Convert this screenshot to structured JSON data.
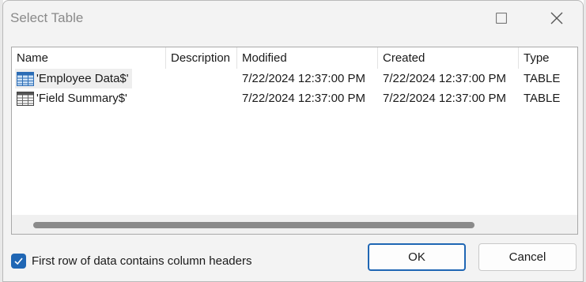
{
  "window": {
    "title": "Select Table"
  },
  "table": {
    "columns": [
      "Name",
      "Description",
      "Modified",
      "Created",
      "Type"
    ],
    "rows": [
      {
        "name": "'Employee Data$'",
        "description": "",
        "modified": "7/22/2024 12:37:00 PM",
        "created": "7/22/2024 12:37:00 PM",
        "type": "TABLE",
        "icon": "table-icon"
      },
      {
        "name": "'Field Summary$'",
        "description": "",
        "modified": "7/22/2024 12:37:00 PM",
        "created": "7/22/2024 12:37:00 PM",
        "type": "TABLE",
        "icon": "table-icon"
      }
    ]
  },
  "options": {
    "header_checkbox_label": "First row of data contains column headers",
    "header_checkbox_checked": true
  },
  "buttons": {
    "ok": "OK",
    "cancel": "Cancel"
  },
  "colors": {
    "accent": "#1f66b4",
    "scroll_thumb": "#8b8b8b"
  }
}
